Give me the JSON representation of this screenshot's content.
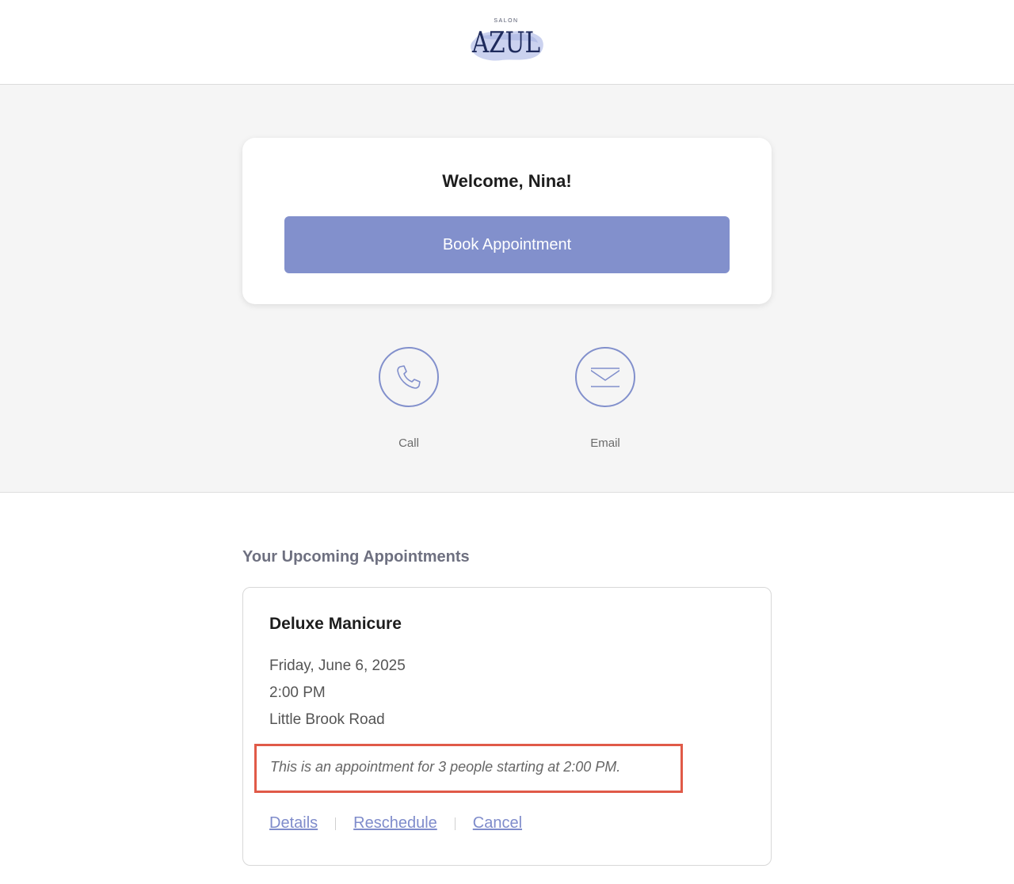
{
  "brand": {
    "small_text": "SALON",
    "name": "AZUL",
    "wash_color": "#b9c3ea",
    "text_color": "#1e2a5c"
  },
  "welcome": {
    "title": "Welcome, Nina!",
    "book_button_label": "Book Appointment"
  },
  "contact": {
    "call_label": "Call",
    "call_icon": "phone-icon",
    "email_label": "Email",
    "email_icon": "envelope-icon"
  },
  "appointments": {
    "section_title": "Your Upcoming Appointments",
    "items": [
      {
        "service": "Deluxe Manicure",
        "date": "Friday, June 6, 2025",
        "time": "2:00 PM",
        "location": "Little Brook Road",
        "note": "This is an appointment for 3 people starting at 2:00 PM.",
        "actions": {
          "details": "Details",
          "reschedule": "Reschedule",
          "cancel": "Cancel"
        }
      }
    ]
  },
  "colors": {
    "accent": "#8290cc",
    "link": "#7f8ccb",
    "highlight_border": "#e05a48",
    "hero_bg": "#f5f5f5"
  }
}
